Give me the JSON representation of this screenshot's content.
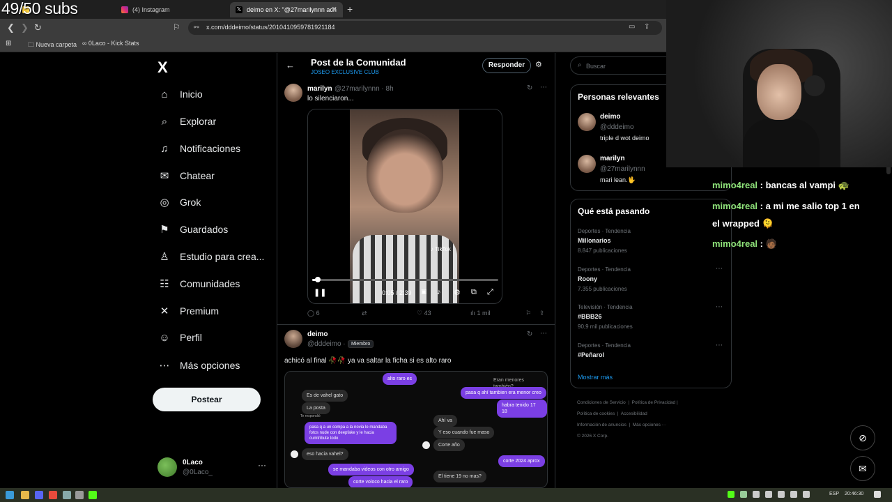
{
  "overlay": {
    "subs_counter": "49/50 subs"
  },
  "browser": {
    "tabs": [
      {
        "label": "",
        "favicon_color": "#ffd23f"
      },
      {
        "label": "(4) Instagram",
        "favicon_color": "#e1306c"
      },
      {
        "label": "deimo en X: \"@27marilynnn ach",
        "favicon_color": "#ffffff"
      }
    ],
    "new_tab": "+",
    "url": "x.com/dddeimo/status/2010410959781921184",
    "bookmarks": [
      {
        "label": "Nueva carpeta"
      },
      {
        "label": "0Laco - Kick Stats"
      }
    ]
  },
  "sidebar": {
    "logo": "X",
    "items": [
      {
        "label": "Inicio",
        "icon": "⌂"
      },
      {
        "label": "Explorar",
        "icon": "⌕"
      },
      {
        "label": "Notificaciones",
        "icon": "♫"
      },
      {
        "label": "Chatear",
        "icon": "✉"
      },
      {
        "label": "Grok",
        "icon": "◎"
      },
      {
        "label": "Guardados",
        "icon": "⚑"
      },
      {
        "label": "Estudio para crea...",
        "icon": "♙"
      },
      {
        "label": "Comunidades",
        "icon": "☷"
      },
      {
        "label": "Premium",
        "icon": "✕"
      },
      {
        "label": "Perfil",
        "icon": "☺"
      },
      {
        "label": "Más opciones",
        "icon": "⋯"
      }
    ],
    "post_button": "Postear",
    "profile": {
      "name": "0Laco",
      "handle": "@0Laco_",
      "more": "···"
    }
  },
  "main": {
    "header": {
      "back": "←",
      "title": "Post de la Comunidad",
      "subtitle": "JOSEO EXCLUSIVE CLUB",
      "reply_button": "Responder",
      "filter_icon": "⚙"
    },
    "post1": {
      "name": "marilyn",
      "meta": "@27marilynnn · 8h",
      "text": "lo silenciaron...",
      "video": {
        "watermark": "♪ TikTok",
        "time": "0:05 / 2:39",
        "progress": 0.03
      },
      "stats": {
        "replies": "6",
        "reposts": "",
        "likes": "43",
        "views": "1 mil"
      }
    },
    "post2": {
      "name": "deimo",
      "meta": "@dddeimo ·",
      "badge": "Miembro",
      "text": "achicó al final 🥀🥀 ya va saltar la ficha  si es alto raro",
      "chat": {
        "b1": "alto raro es",
        "b2": "Eran menores también?",
        "b3": "Es de vahel gato",
        "b4": "pasa q ahí tambien era menor creo",
        "b5": "La posta",
        "b6": "habra tenido 17 18",
        "b7": "Te respondió",
        "b8": "Ahí va",
        "b9": "pasa q a un compa a la novia le mandaba fotos nude con deepfake y le hacia cumtribute todo",
        "b10": "Y eso cuando fue maso",
        "b11": "Corte año",
        "b12": "eso hacia vahel?",
        "b13": "corte 2024 aprox",
        "b14": "se mandaba videos con otro amigo",
        "b15": "El tiene 19 no mas?",
        "b16": "corte voloco hacia el raro"
      }
    }
  },
  "right": {
    "search_placeholder": "Buscar",
    "relevant": {
      "title": "Personas relevantes",
      "people": [
        {
          "name": "deimo",
          "handle": "@dddeimo",
          "bio": "triple d wot deimo"
        },
        {
          "name": "marilyn",
          "handle": "@27marilynnn",
          "bio": "mari lean.🖖"
        }
      ]
    },
    "trends": {
      "title": "Qué está pasando",
      "items": [
        {
          "category": "Deportes · Tendencia",
          "name": "Millonarios",
          "count": "8.847 publicaciones"
        },
        {
          "category": "Deportes · Tendencia",
          "name": "Roony",
          "count": "7.355 publicaciones"
        },
        {
          "category": "Televisión · Tendencia",
          "name": "#BBB26",
          "count": "90,9 mil publicaciones"
        },
        {
          "category": "Deportes · Tendencia",
          "name": "#Peñarol",
          "count": ""
        }
      ],
      "show_more": "Mostrar más"
    },
    "footer": {
      "l1": "Condiciones de Servicio",
      "l2": "Política de Privacidad",
      "l3": "Política de cookies",
      "l4": "Accesibilidad",
      "l5": "Información de anuncios",
      "l6": "Más opciones ···",
      "l7": "© 2026 X Corp."
    }
  },
  "stream_chat": {
    "messages": [
      {
        "user": "mimo4real",
        "text": " : bancas al vampi 🐢"
      },
      {
        "user": "mimo4real",
        "text": " : a mi me salio top 1 en"
      },
      {
        "user": "",
        "text": "el wrapped 🫠"
      },
      {
        "user": "mimo4real",
        "text": " : 🧑🏾"
      }
    ]
  },
  "taskbar": {
    "language": "ESP",
    "time": "20:46:30"
  }
}
